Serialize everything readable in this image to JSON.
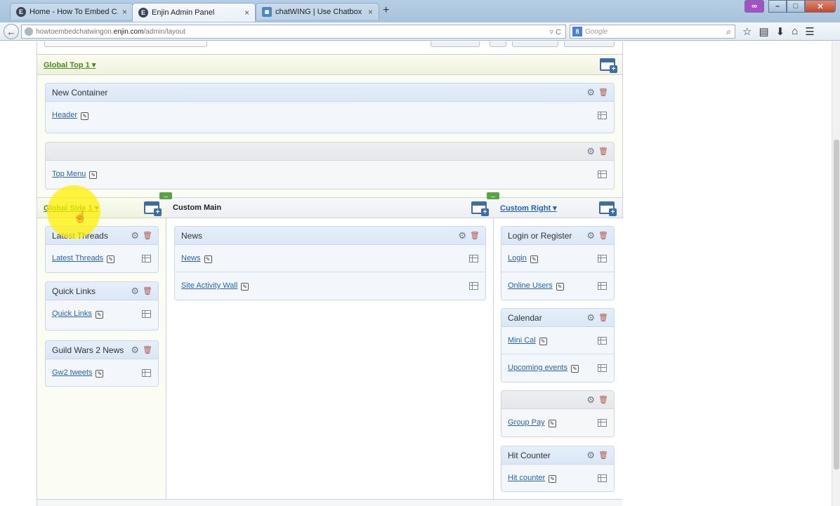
{
  "browser": {
    "tabs": [
      {
        "title": "Home - How To Embed C...",
        "close": "×",
        "favicon": "E"
      },
      {
        "title": "Enjin Admin Panel",
        "close": "×",
        "favicon": "E"
      },
      {
        "title": "chatWING | Use Chatbox",
        "close": "×",
        "favicon": "chat"
      }
    ],
    "new_tab": "+",
    "url_prefix": "howtoembedchatwingon.",
    "url_domain": "enjin.com",
    "url_path": "/admin/layout",
    "url_controls": "▿ C",
    "search_engine": "8",
    "search_placeholder": "Google",
    "icons": [
      "star-icon",
      "reading-list-icon",
      "download-icon",
      "home-icon",
      "menu-icon"
    ]
  },
  "layout": {
    "global_top": {
      "title": "Global Top 1 ▾"
    },
    "top_containers": [
      {
        "title": "New Container",
        "modules": [
          {
            "label": "Header"
          }
        ]
      },
      {
        "title": "",
        "modules": [
          {
            "label": "Top Menu"
          }
        ]
      }
    ],
    "columns": {
      "left": {
        "title": "Global Side 1 ▾",
        "containers": [
          {
            "title": "Latest Threads",
            "modules": [
              {
                "label": "Latest Threads"
              }
            ]
          },
          {
            "title": "Quick Links",
            "modules": [
              {
                "label": "Quick Links"
              }
            ]
          },
          {
            "title": "Guild Wars 2 News",
            "modules": [
              {
                "label": "Gw2 tweets"
              }
            ]
          }
        ]
      },
      "main": {
        "title": "Custom Main",
        "containers": [
          {
            "title": "News",
            "modules": [
              {
                "label": "News"
              },
              {
                "label": "Site Activity Wall"
              }
            ]
          }
        ]
      },
      "right": {
        "title": "Custom Right ▾",
        "containers": [
          {
            "title": "Login or Register",
            "modules": [
              {
                "label": "Login"
              },
              {
                "label": "Online Users"
              }
            ]
          },
          {
            "title": "Calendar",
            "modules": [
              {
                "label": "Mini Cal"
              },
              {
                "label": "Upcoming events"
              }
            ]
          },
          {
            "title": "",
            "modules": [
              {
                "label": "Group Pay"
              }
            ]
          },
          {
            "title": "Hit Counter",
            "modules": [
              {
                "label": "Hit counter"
              }
            ]
          }
        ]
      }
    }
  }
}
